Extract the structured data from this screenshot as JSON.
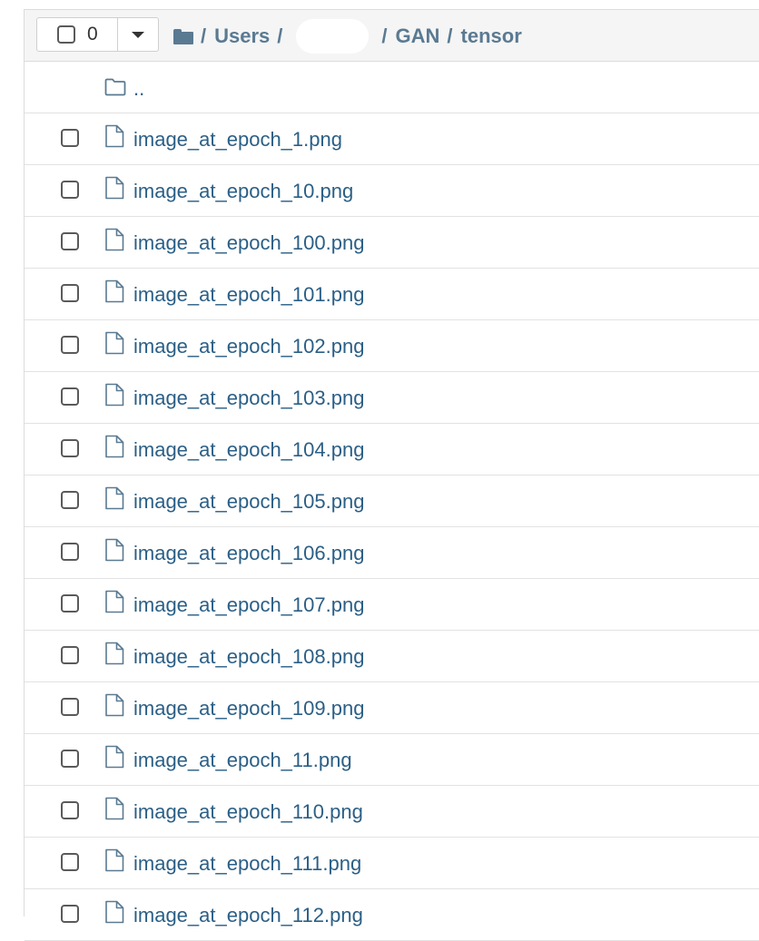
{
  "toolbar": {
    "selected_count": "0",
    "checkbox_icon": "checkbox-icon",
    "caret_icon": "caret-down-icon"
  },
  "breadcrumb": {
    "root_icon": "folder-icon",
    "separator": "/",
    "items": [
      "Users",
      "GAN",
      "tensor"
    ]
  },
  "list": {
    "parent_dir": "..",
    "files": [
      "image_at_epoch_1.png",
      "image_at_epoch_10.png",
      "image_at_epoch_100.png",
      "image_at_epoch_101.png",
      "image_at_epoch_102.png",
      "image_at_epoch_103.png",
      "image_at_epoch_104.png",
      "image_at_epoch_105.png",
      "image_at_epoch_106.png",
      "image_at_epoch_107.png",
      "image_at_epoch_108.png",
      "image_at_epoch_109.png",
      "image_at_epoch_11.png",
      "image_at_epoch_110.png",
      "image_at_epoch_111.png",
      "image_at_epoch_112.png"
    ]
  },
  "colors": {
    "link": "#2b5f86",
    "breadcrumb": "#5a7a92",
    "header_bg": "#f5f5f5",
    "border": "#e2e2e2"
  }
}
